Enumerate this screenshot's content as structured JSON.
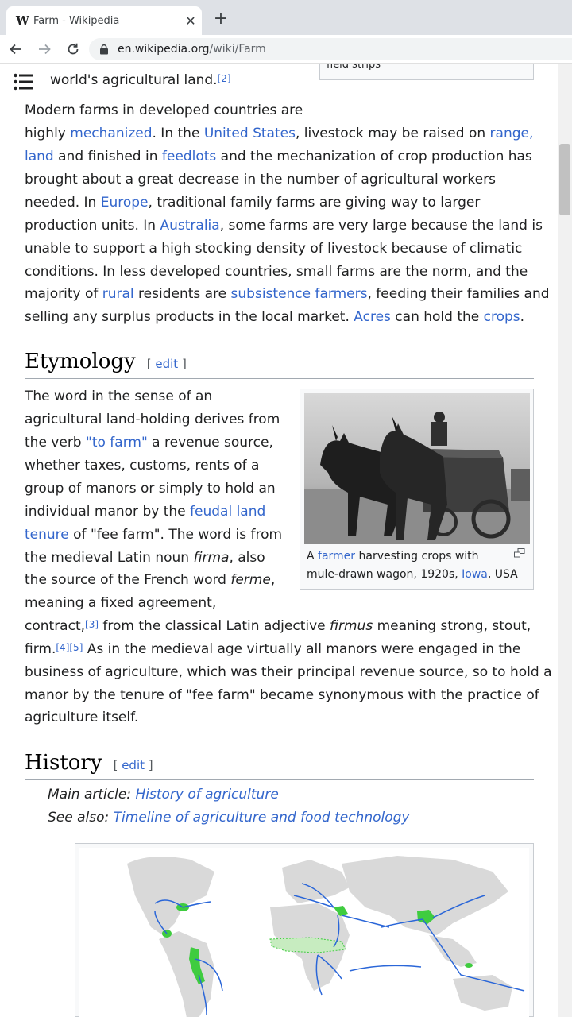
{
  "browser": {
    "tab_title": "Farm - Wikipedia",
    "tab_favicon": "W",
    "close_glyph": "✕",
    "newtab_glyph": "+",
    "url_domain": "en.wikipedia.org",
    "url_path": "/wiki/Farm"
  },
  "infobox_partial": "field strips",
  "intro": {
    "line_top_text": "world's agricultural land.",
    "line_top_ref": "[2]",
    "para": {
      "s1": "Modern farms in developed countries are",
      "s2a": "highly ",
      "l_mechanized": "mechanized",
      "s2b": ". In the ",
      "l_us": "United States",
      "s2c": ", livestock may be raised on ",
      "l_range1": "range,",
      "l_range2": "land",
      "s3a": " and finished in ",
      "l_feedlots": "feedlots",
      "s3b": " and the mechanization of crop production has",
      "s4": "brought about a great decrease in the number of agricultural workers",
      "s5a": "needed. In ",
      "l_europe": "Europe",
      "s5b": ", traditional family farms are giving way to larger",
      "s6a": "production units. In ",
      "l_australia": "Australia",
      "s6b": ", some farms are very large because the land is",
      "s7": "unable to support a high stocking density of livestock because of climatic",
      "s8": "conditions. In less developed countries, small farms are the norm, and the",
      "s9a": "majority of ",
      "l_rural": "rural",
      "s9b": " residents are ",
      "l_subsistence": "subsistence farmers",
      "s9c": ", feeding their families and",
      "s10a": "selling any surplus products in the local market. ",
      "l_acres": "Acres",
      "s10b": " can hold the ",
      "l_crops": "crops",
      "s10c": "."
    }
  },
  "etymology": {
    "heading": "Etymology",
    "edit_open": "[ ",
    "edit_label": "edit",
    "edit_close": " ]",
    "lines": {
      "a1": "The word in the sense of an",
      "a2": "agricultural land-holding derives from",
      "a3a": "the verb ",
      "l_tofarm": "\"to farm\"",
      "a3b": " a revenue source,",
      "a4": "whether taxes, customs, rents of a",
      "a5": "group of manors or simply to hold an",
      "a6a": "individual manor by the ",
      "l_feudal1": "feudal land",
      "l_feudal2": "tenure",
      "a7b": " of \"fee farm\". The word is from",
      "a8a": "the medieval Latin noun ",
      "a8i": "firma",
      "a8b": ", also",
      "a9a": "the source of the French word ",
      "a9i": "ferme",
      "a9b": ",",
      "a10": "meaning a fixed agreement,",
      "a11a": "contract,",
      "r3": "[3]",
      "a11b": " from the classical Latin adjective ",
      "a11i": "firmus",
      "a11c": " meaning strong, stout,",
      "a12a": "firm.",
      "r45": "[4][5]",
      "a12b": " As in the medieval age virtually all manors were engaged in the",
      "a13": "business of agriculture, which was their principal revenue source, so to hold a",
      "a14": "manor by the tenure of \"fee farm\" became synonymous with the practice of",
      "a15": "agriculture itself."
    },
    "thumb": {
      "cap_a": "A ",
      "l_farmer": "farmer",
      "cap_b": " harvesting crops with",
      "cap_c": "mule-drawn wagon, 1920s, ",
      "l_iowa": "Iowa",
      "cap_d": ", USA"
    }
  },
  "history": {
    "heading": "History",
    "edit_open": "[ ",
    "edit_label": "edit",
    "edit_close": " ]",
    "main_label": "Main article: ",
    "main_link": "History of agriculture",
    "see_label": "See also: ",
    "see_link": "Timeline of agriculture and food technology"
  },
  "colors": {
    "link": "#3366cc",
    "map_origin_green": "#3fcc3f",
    "map_arrow_blue": "#2a66d8",
    "map_land": "#d9d9d9"
  }
}
